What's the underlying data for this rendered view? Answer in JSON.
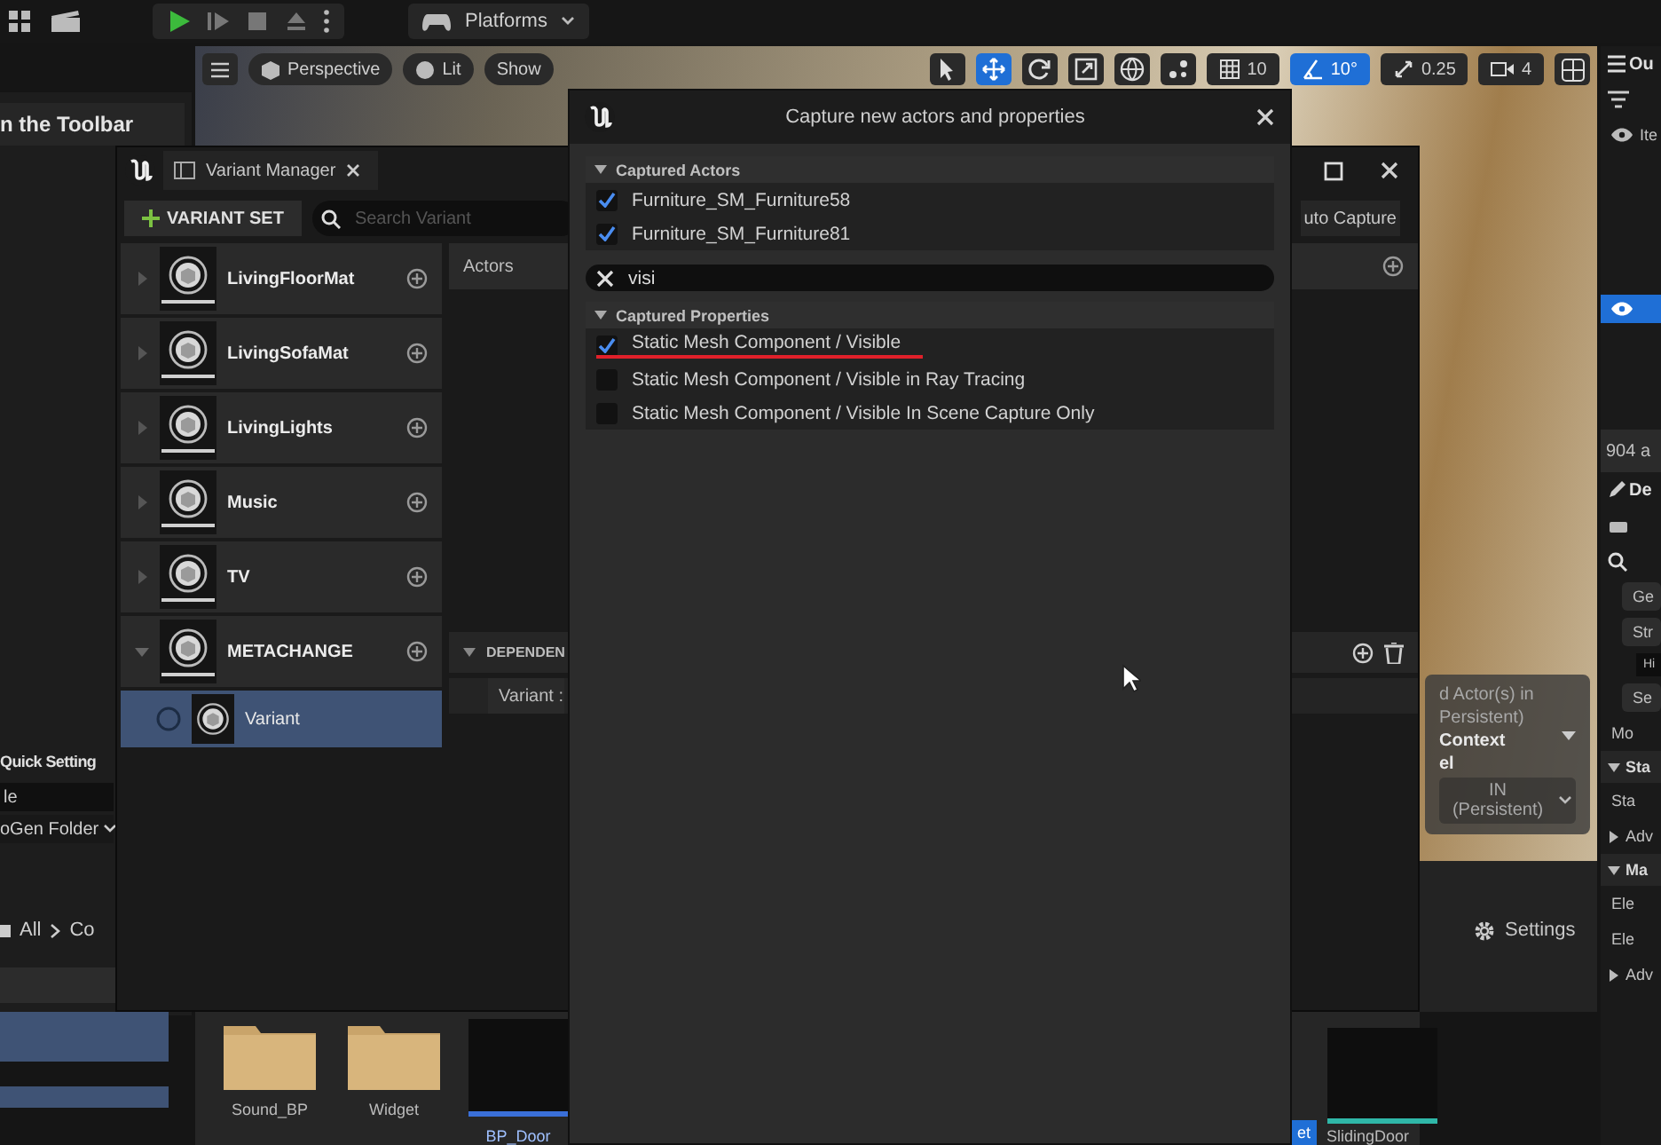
{
  "toolbar": {
    "platforms": "Platforms"
  },
  "viewport": {
    "buttons": [
      {
        "label": "Perspective",
        "kind": "perspective"
      },
      {
        "label": "Lit",
        "kind": "lit"
      },
      {
        "label": "Show",
        "kind": "plain"
      }
    ],
    "tools": [
      {
        "kind": "select",
        "selected": false
      },
      {
        "kind": "move",
        "selected": true
      },
      {
        "kind": "rotate",
        "selected": false
      },
      {
        "kind": "scale",
        "selected": false
      }
    ],
    "grid_snap": {
      "value": "10",
      "on": false
    },
    "angle_snap": {
      "value": "10°",
      "on": true
    },
    "scale_snap": {
      "value": "0.25",
      "on": false
    },
    "camera_speed": "4",
    "overlay": {
      "lines": [
        "d Actor(s) in",
        "Persistent)"
      ],
      "context": "Context",
      "level_label": "el",
      "level_value": "IN (Persistent)"
    }
  },
  "left_panel": {
    "title": "n the Toolbar",
    "quick_settings": "Quick Setting",
    "field": "le",
    "folder": "oGen Folder",
    "breadcrumbs": [
      "All",
      "Co"
    ]
  },
  "content_browser": {
    "items": [
      {
        "label": "Sound_BP",
        "kind": "folder",
        "selected": false
      },
      {
        "label": "Widget",
        "kind": "folder",
        "selected": false
      },
      {
        "label": "BP_Door",
        "kind": "asset",
        "selected": true
      }
    ],
    "right_items": [
      {
        "label": "et",
        "kind": "label",
        "selected": true
      },
      {
        "label": "SlidingDoor",
        "kind": "asset",
        "selected": false
      }
    ],
    "settings": "Settings"
  },
  "outliner": {
    "title": "Ou",
    "column": "Ite",
    "count": "904 a",
    "details": "De",
    "rows": [
      {
        "label": "Ge",
        "kind": "button"
      },
      {
        "label": "Str",
        "kind": "button"
      },
      {
        "label": "Hi",
        "kind": "small"
      },
      {
        "label": "Se",
        "kind": "button"
      },
      {
        "label": "Mo",
        "kind": "text"
      },
      {
        "label": "Sta",
        "kind": "section"
      },
      {
        "label": "Sta",
        "kind": "text"
      },
      {
        "label": "Adv",
        "kind": "collapsed"
      },
      {
        "label": "Ma",
        "kind": "section"
      },
      {
        "label": "Ele",
        "kind": "text"
      },
      {
        "label": "Ele",
        "kind": "text"
      },
      {
        "label": "Adv",
        "kind": "collapsed"
      }
    ]
  },
  "variant_manager": {
    "tab": "Variant Manager",
    "add_button": "VARIANT SET",
    "search": {
      "placeholder": "Search Variant"
    },
    "auto_capture": "uto Capture",
    "sets": [
      {
        "name": "LivingFloorMat",
        "expanded": false
      },
      {
        "name": "LivingSofaMat",
        "expanded": false
      },
      {
        "name": "LivingLights",
        "expanded": false
      },
      {
        "name": "Music",
        "expanded": false
      },
      {
        "name": "TV",
        "expanded": false
      },
      {
        "name": "METACHANGE",
        "expanded": true,
        "variants": [
          {
            "name": "Variant",
            "selected": true
          }
        ]
      }
    ],
    "actors_header": "Actors",
    "dependencies_header": "DEPENDEN",
    "dependency_column": "Variant :"
  },
  "dialog": {
    "title": "Capture new actors and properties",
    "actors_section": {
      "title": "Captured Actors",
      "expanded": true,
      "items": [
        {
          "label": "Furniture_SM_Furniture58",
          "checked": true
        },
        {
          "label": "Furniture_SM_Furniture81",
          "checked": true
        }
      ]
    },
    "filter": {
      "value": "visi"
    },
    "properties_section": {
      "title": "Captured Properties",
      "expanded": true,
      "items": [
        {
          "label": "Static Mesh Component / Visible",
          "checked": true,
          "underlined": true
        },
        {
          "label": "Static Mesh Component / Visible in Ray Tracing",
          "checked": false,
          "underlined": false
        },
        {
          "label": "Static Mesh Component / Visible In Scene Capture Only",
          "checked": false,
          "underlined": false
        }
      ]
    }
  }
}
